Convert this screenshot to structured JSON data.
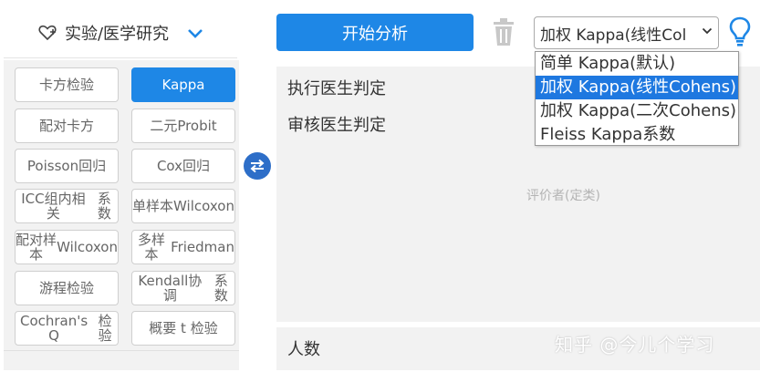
{
  "category": {
    "title": "实验/医学研究"
  },
  "methods": [
    [
      "卡方检验",
      "Kappa"
    ],
    [
      "配对卡方",
      "二元Probit"
    ],
    [
      "Poisson回归",
      "Cox回归"
    ],
    [
      "ICC组内相关\n系数",
      "单样本\nWilcoxon"
    ],
    [
      "配对样本\nWilcoxon",
      "多样本\nFriedman"
    ],
    [
      "游程检验",
      "Kendall协调\n系数"
    ],
    [
      "Cochran's Q\n检验",
      "概要 t 检验"
    ]
  ],
  "active_method": "Kappa",
  "toolbar": {
    "start_label": "开始分析",
    "select_value": "加权 Kappa(线性Col"
  },
  "dropdown": {
    "options": [
      "简单 Kappa(默认)",
      "加权 Kappa(线性Cohens)",
      "加权 Kappa(二次Cohens)",
      "Fleiss Kappa系数"
    ],
    "selected_index": 1
  },
  "fields": {
    "field1": "执行医生判定",
    "field2": "审核医生判定",
    "placeholder": "评价者(定类)",
    "count_label": "人数"
  },
  "watermark": "知乎 @今儿个学习",
  "colors": {
    "accent": "#1e87e6",
    "panel_bg": "#f2f2f2",
    "swap": "#2d6ec8"
  }
}
